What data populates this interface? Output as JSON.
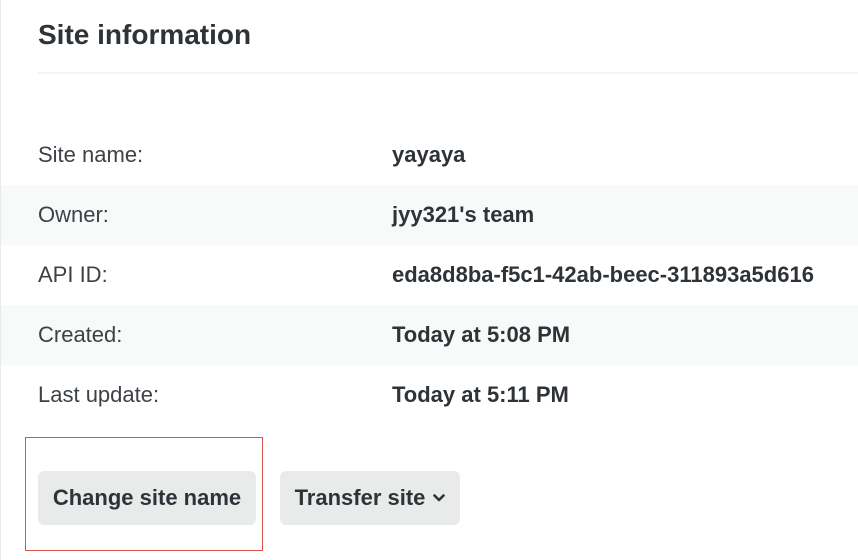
{
  "section": {
    "title": "Site information"
  },
  "info_rows": [
    {
      "label": "Site name:",
      "value": "yayaya"
    },
    {
      "label": "Owner:",
      "value": "jyy321's team"
    },
    {
      "label": "API ID:",
      "value": "eda8d8ba-f5c1-42ab-beec-311893a5d616"
    },
    {
      "label": "Created:",
      "value": "Today at 5:08 PM"
    },
    {
      "label": "Last update:",
      "value": "Today at 5:11 PM"
    }
  ],
  "actions": {
    "change_site_name_label": "Change site name",
    "transfer_site_label": "Transfer site",
    "transfer_site_icon": "chevron-down-icon"
  },
  "colors": {
    "highlight_border": "#d9534f",
    "button_bg": "#e9ebeb",
    "alt_row_bg": "#f8faf9"
  }
}
